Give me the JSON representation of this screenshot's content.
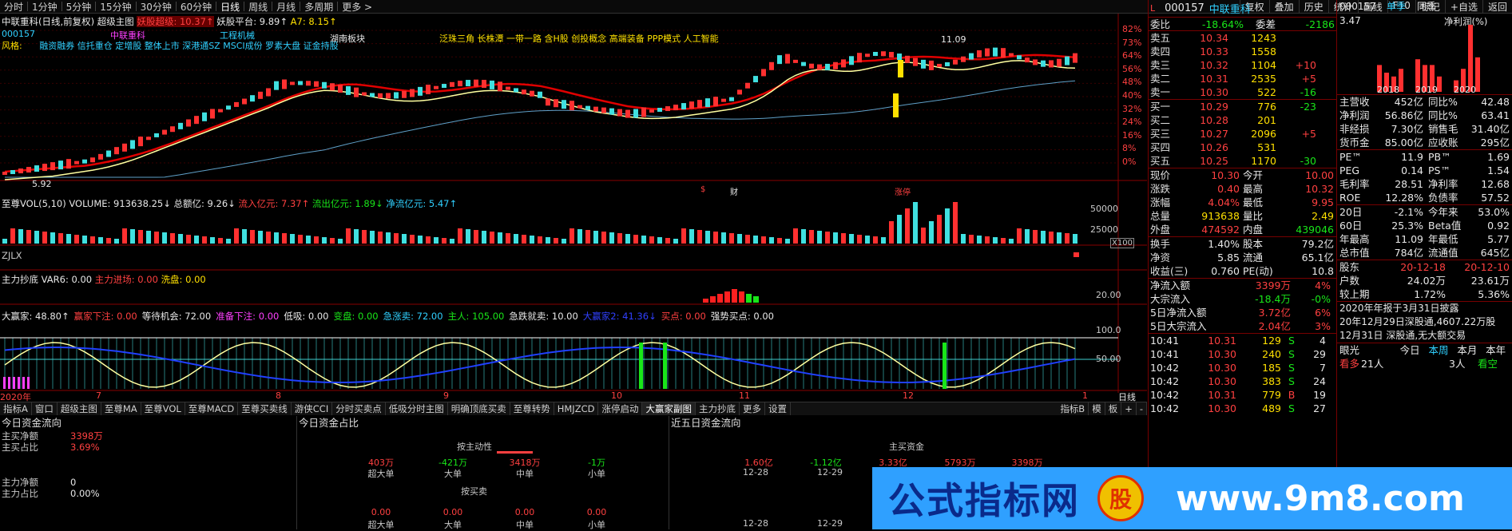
{
  "topbar": {
    "items": [
      "分时",
      "1分钟",
      "5分钟",
      "15分钟",
      "30分钟",
      "60分钟",
      "日线",
      "周线",
      "月线",
      "多周期",
      "更多 >"
    ],
    "tools": [
      "复权",
      "叠加",
      "历史",
      "统计",
      "画线",
      "F10",
      "标记",
      "+自选",
      "返回"
    ]
  },
  "main": {
    "title": "中联重科(日线,前复权)",
    "indicator": "超级主图",
    "ind_a": "妖股超级: 10.37↑",
    "ind_b": "妖股平台: 9.89↑",
    "ind_c": "A7: 8.15↑",
    "code": "000157",
    "fg_label": "风格:",
    "styles": "融资融券 信托重仓 定增股 整体上市 深港通SZ MSCI成份 罗素大盘 证金持股",
    "sector1": "中联重科",
    "sector2": "工程机械",
    "sector3": "湖南板块",
    "concepts": "泛珠三角 长株潭 一带一路 含H股 创投概念 高端装备 PPP模式 人工智能",
    "hi_label": "11.09",
    "lo_label": "5.92",
    "pct": [
      "82%",
      "73%",
      "64%",
      "56%",
      "48%",
      "40%",
      "32%",
      "24%",
      "16%",
      "8%",
      "0%"
    ],
    "marks": [
      "$",
      "财",
      "涨停"
    ]
  },
  "vol": {
    "title": "至尊VOL(5,10)",
    "v1": "VOLUME: 913638.25↓",
    "v2": "总额亿: 9.26↓",
    "v3": "流入亿元: 7.37↑",
    "v4": "流出亿元: 1.89↓",
    "v5": "净流亿元: 5.47↑",
    "ticks": [
      "50000",
      "25000",
      "X100"
    ]
  },
  "zjlx": {
    "title": "ZJLX"
  },
  "cd": {
    "title": "主力抄底",
    "v1": "VAR6: 0.00",
    "v2": "主力进场: 0.00",
    "v3": "洗盘: 0.00",
    "tick": "20.00"
  },
  "dy": {
    "title": "大赢家副图",
    "items": [
      [
        "大赢家: 48.80↑",
        "#e8e8e8"
      ],
      [
        "赢家下注: 0.00",
        "#ff4040"
      ],
      [
        "等待机会: 72.00",
        "#e8e8e8"
      ],
      [
        "准备下注: 0.00",
        "#ff40ff"
      ],
      [
        "低吸: 0.00",
        "#e8e8e8"
      ],
      [
        "变盘: 0.00",
        "#19e619"
      ],
      [
        "急涨卖: 72.00",
        "#30d0ff"
      ],
      [
        "主人: 105.00",
        "#19e619"
      ],
      [
        "急跌就卖: 10.00",
        "#e8e8e8"
      ],
      [
        "大赢家2: 41.36↓",
        "#3040ff"
      ],
      [
        "买点: 0.00",
        "#ff4040"
      ],
      [
        "强势买点: 0.00",
        "#e8e8e8"
      ]
    ],
    "ticks": [
      "100.0",
      "50.00"
    ]
  },
  "xaxis": {
    "labels": [
      "2020年",
      "7",
      "8",
      "9",
      "10",
      "11",
      "12",
      "1"
    ],
    "period": "日线"
  },
  "bottabs": [
    "指标A",
    "窗口",
    "超级主图",
    "至尊MA",
    "至尊VOL",
    "至尊MACD",
    "至尊买卖线",
    "游侠CCI",
    "分时买卖点",
    "低吸分时主图",
    "明确顶底买卖",
    "至尊转势",
    "HMJZCD",
    "涨停启动",
    "大赢家副图",
    "主力抄底",
    "更多",
    "设置"
  ],
  "bottabs_right": [
    "指标B",
    "模",
    "板",
    "+",
    "-"
  ],
  "p1": {
    "title": "今日资金流向",
    "r1": [
      "主买净额",
      "3398万"
    ],
    "r2": [
      "主买占比",
      "3.69%"
    ],
    "r3": [
      "主力净额",
      "0"
    ],
    "r4": [
      "主力占比",
      "0.00%"
    ]
  },
  "p2": {
    "title": "今日资金占比",
    "h1": "按主动性",
    "vals1": [
      "403万",
      "-421万",
      "3418万",
      "-1万"
    ],
    "cats": [
      "超大单",
      "大单",
      "中单",
      "小单"
    ],
    "h2": "按买卖",
    "vals2": [
      "0.00",
      "0.00",
      "0.00",
      "0.00"
    ]
  },
  "p3": {
    "title": "近五日资金流向",
    "h1": "主买资金",
    "vals": [
      "1.60亿",
      "-1.12亿",
      "3.33亿",
      "5793万",
      "3398万"
    ],
    "dates": [
      "12-28",
      "12-29"
    ]
  },
  "quote": {
    "code": "000157",
    "name": "中联重科",
    "wb_label": "委比",
    "wb": "-18.64%",
    "wc_label": "委差",
    "wc": "-2186",
    "sells": [
      [
        "卖五",
        "10.34",
        "1243",
        ""
      ],
      [
        "卖四",
        "10.33",
        "1558",
        ""
      ],
      [
        "卖三",
        "10.32",
        "1104",
        "+10"
      ],
      [
        "卖二",
        "10.31",
        "2535",
        "+5"
      ],
      [
        "卖一",
        "10.30",
        "522",
        "-16"
      ]
    ],
    "buys": [
      [
        "买一",
        "10.29",
        "776",
        "-23"
      ],
      [
        "买二",
        "10.28",
        "201",
        ""
      ],
      [
        "买三",
        "10.27",
        "2096",
        "+5"
      ],
      [
        "买四",
        "10.26",
        "531",
        ""
      ],
      [
        "买五",
        "10.25",
        "1170",
        "-30"
      ]
    ],
    "stats": [
      [
        "现价",
        "10.30",
        "今开",
        "10.00"
      ],
      [
        "涨跌",
        "0.40",
        "最高",
        "10.32"
      ],
      [
        "涨幅",
        "4.04%",
        "最低",
        "9.95"
      ],
      [
        "总量",
        "913638",
        "量比",
        "2.49"
      ],
      [
        "外盘",
        "474592",
        "内盘",
        "439046"
      ]
    ],
    "stats2": [
      [
        "换手",
        "1.40%",
        "股本",
        "79.2亿"
      ],
      [
        "净资",
        "5.85",
        "流通",
        "65.1亿"
      ],
      [
        "收益(三)",
        "0.760",
        "PE(动)",
        "10.8"
      ]
    ],
    "flow": [
      [
        "净流入额",
        "3399万",
        "4%"
      ],
      [
        "大宗流入",
        "-18.4万",
        "-0%"
      ],
      [
        "5日净流入额",
        "3.72亿",
        "6%"
      ],
      [
        "5日大宗流入",
        "2.04亿",
        "3%"
      ]
    ],
    "ticks": [
      [
        "10:41",
        "10.31",
        "129",
        "S",
        "4"
      ],
      [
        "10:41",
        "10.30",
        "240",
        "S",
        "29"
      ],
      [
        "10:42",
        "10.30",
        "185",
        "S",
        "7"
      ],
      [
        "10:42",
        "10.30",
        "383",
        "S",
        "24"
      ],
      [
        "10:42",
        "10.31",
        "779",
        "B",
        "19"
      ],
      [
        "10:42",
        "10.30",
        "489",
        "S",
        "27"
      ]
    ]
  },
  "fin": {
    "code": "000157",
    "tabs": [
      "单季",
      "同季",
      "净利润(%)"
    ],
    "ymax": "3.47",
    "years": [
      "2018",
      "2019",
      "2020"
    ],
    "rows": [
      [
        "主营收",
        "452亿",
        "同比%",
        "42.48"
      ],
      [
        "净利润",
        "56.86亿",
        "同比%",
        "63.41"
      ],
      [
        "非经损",
        "7.30亿",
        "销售毛",
        "31.40亿"
      ],
      [
        "货币金",
        "85.00亿",
        "应收账",
        "295亿"
      ]
    ],
    "rows2": [
      [
        "PE™",
        "11.9",
        "PB™",
        "1.69"
      ],
      [
        "PEG",
        "0.14",
        "PS™",
        "1.54"
      ],
      [
        "毛利率",
        "28.51",
        "净利率",
        "12.68"
      ],
      [
        "ROE",
        "12.28%",
        "负债率",
        "57.52"
      ]
    ],
    "rows3": [
      [
        "20日",
        "-2.1%",
        "今年来",
        "53.0%"
      ],
      [
        "60日",
        "25.3%",
        "Beta值",
        "0.92"
      ],
      [
        "年最高",
        "11.09",
        "年最低",
        "5.77"
      ],
      [
        "总市值",
        "784亿",
        "流通值",
        "645亿"
      ]
    ],
    "holders": [
      [
        "股东",
        "20-12-18",
        "20-12-10"
      ],
      [
        "户数",
        "24.02万",
        "23.61万"
      ],
      [
        "较上期",
        "1.72%",
        "5.36%"
      ]
    ],
    "notes": [
      "2020年年报于3月31日披露",
      "20年12月29日深股通,4607.22万股",
      "12月31日 深股通,无大额交易"
    ],
    "bottom": [
      "眼光",
      "今日",
      "本周",
      "本月",
      "本年"
    ],
    "bottom2": [
      "看多",
      "21人",
      "3人",
      "看空"
    ]
  },
  "watermark": {
    "t1": "公式指标网",
    "t2": "www.9m8.com",
    "stamp": "股"
  }
}
